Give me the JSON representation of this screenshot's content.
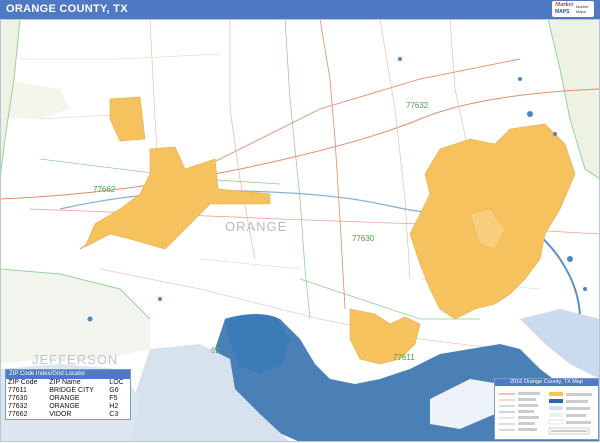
{
  "header": {
    "title": "ORANGE COUNTY, TX",
    "logo_line1": "Market",
    "logo_line2": "MAPS",
    "logo_line3": "Market Maps"
  },
  "map": {
    "county_label": "ORANGE",
    "neighbor_county_label": "JEFFERSON",
    "zip_labels": [
      "77632",
      "77662",
      "77630",
      "77611"
    ],
    "highway_label": "62",
    "colors": {
      "city_fill": "#f6c25e",
      "water": "#2a6aa8",
      "water_light": "#d6e3ef",
      "land_outside": "#eef2e2",
      "roads_major": "#e28b6a",
      "roads_minor": "#e9b3a3",
      "zip_boundary": "#7ccf7c",
      "title_bar": "#4f79c4"
    }
  },
  "zip_index": {
    "title": "ZIP Code Index/Grid Locator",
    "columns": [
      "ZIP Code",
      "ZIP Name",
      "LOC"
    ],
    "rows": [
      [
        "77611",
        "BRIDGE CITY",
        "G6"
      ],
      [
        "77630",
        "ORANGE",
        "F5"
      ],
      [
        "77632",
        "ORANGE",
        "H2"
      ],
      [
        "77662",
        "VIDOR",
        "C3"
      ]
    ]
  },
  "legend": {
    "title": "2016 Orange County, TX Map"
  }
}
